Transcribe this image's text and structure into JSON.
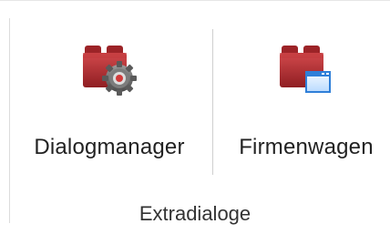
{
  "ribbon_group": {
    "label": "Extradialoge",
    "buttons": [
      {
        "label": "Dialogmanager",
        "icon": "folder-gear-icon"
      },
      {
        "label": "Firmenwagen",
        "icon": "folder-window-icon"
      }
    ]
  },
  "colors": {
    "folder_red": "#b02a2f",
    "folder_dark": "#7a1a1d",
    "gear_gray": "#6d6d6d",
    "window_blue": "#2f7fd8"
  }
}
